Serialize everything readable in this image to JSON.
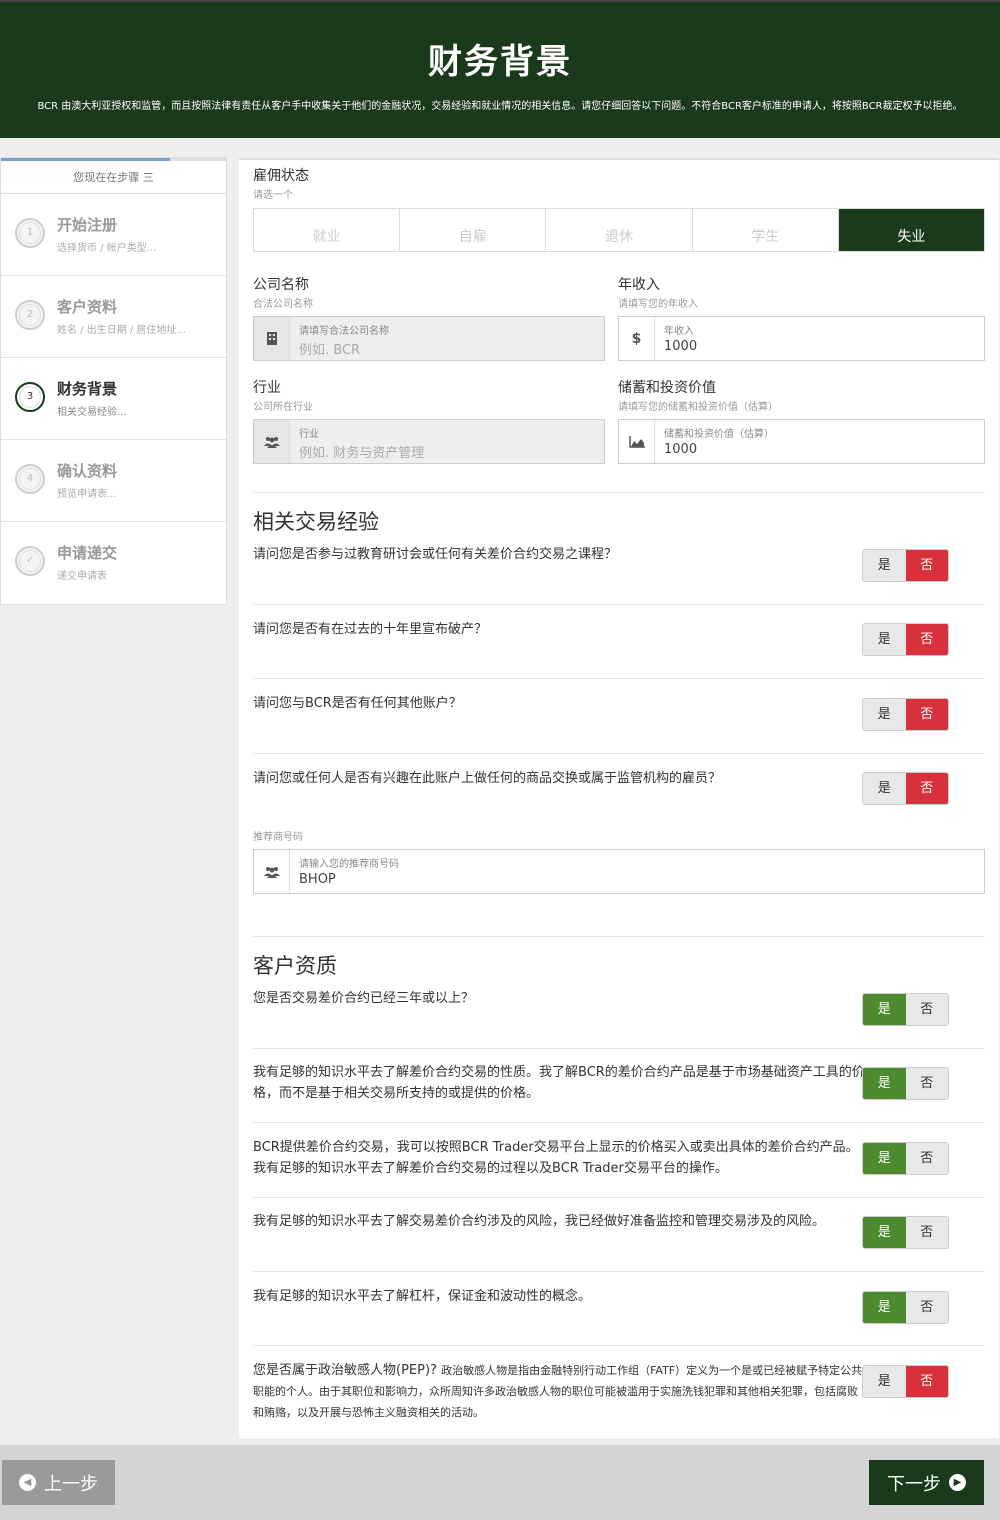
{
  "header": {
    "title": "财务背景",
    "notice": "BCR 由澳大利亚授权和监管，而且按照法律有责任从客户手中收集关于他们的金融状况，交易经验和就业情况的相关信息。请您仔细回答以下问题。不符合BCR客户标准的申请人，将按照BCR裁定权予以拒绝。"
  },
  "sidebar": {
    "progress": 0.75,
    "step_label": "您现在在步骤 三",
    "steps": [
      {
        "num": "1",
        "title": "开始注册",
        "sub": "选择货币 / 帐户类型..."
      },
      {
        "num": "2",
        "title": "客户资料",
        "sub": "姓名 / 出生日期 / 居住地址..."
      },
      {
        "num": "3",
        "title": "财务背景",
        "sub": "相关交易经验..."
      },
      {
        "num": "4",
        "title": "确认资料",
        "sub": "预览申请表..."
      },
      {
        "num": "✓",
        "title": "申请递交",
        "sub": "递交申请表"
      }
    ]
  },
  "employment": {
    "label": "雇佣状态",
    "hint": "请选一个",
    "options": [
      "就业",
      "自雇",
      "退休",
      "学生",
      "失业"
    ],
    "selected": "失业"
  },
  "company": {
    "label": "公司名称",
    "hint": "合法公司名称",
    "field_label": "请填写合法公司名称",
    "placeholder": "例如. BCR"
  },
  "income": {
    "label": "年收入",
    "hint": "请填写您的年收入",
    "field_label": "年收入",
    "value": "1000",
    "icon": "$"
  },
  "industry": {
    "label": "行业",
    "hint": "公司所在行业",
    "field_label": "行业",
    "placeholder": "例如. 财务与资产管理"
  },
  "savings": {
    "label": "储蓄和投资价值",
    "hint": "请填写您的储蓄和投资价值（估算）",
    "field_label": "储蓄和投资价值（估算）",
    "value": "1000"
  },
  "experience": {
    "title": "相关交易经验",
    "yes": "是",
    "no": "否",
    "questions": [
      {
        "text": "请问您是否参与过教育研讨会或任何有关差价合约交易之课程？",
        "answer": "否"
      },
      {
        "text": "请问您是否有在过去的十年里宣布破产？",
        "answer": "否"
      },
      {
        "text": "请问您与BCR是否有任何其他账户？",
        "answer": "否"
      },
      {
        "text": "请问您或任何人是否有兴趣在此账户上做任何的商品交换或属于监管机构的雇员？",
        "answer": "否"
      }
    ]
  },
  "referral": {
    "label": "推荐商号码",
    "field_label": "请输入您的推荐商号码",
    "value": "BHOP"
  },
  "qualification": {
    "title": "客户资质",
    "questions": [
      {
        "text": "您是否交易差价合约已经三年或以上？",
        "answer": "是"
      },
      {
        "text": "我有足够的知识水平去了解差价合约交易的性质。我了解BCR的差价合约产品是基于市场基础资产工具的价格，而不是基于相关交易所支持的或提供的价格。",
        "answer": "是"
      },
      {
        "text": "BCR提供差价合约交易，我可以按照BCR Trader交易平台上显示的价格买入或卖出具体的差价合约产品。我有足够的知识水平去了解差价合约交易的过程以及BCR Trader交易平台的操作。",
        "answer": "是"
      },
      {
        "text": "我有足够的知识水平去了解交易差价合约涉及的风险，我已经做好准备监控和管理交易涉及的风险。",
        "answer": "是"
      },
      {
        "text": "我有足够的知识水平去了解杠杆，保证金和波动性的概念。",
        "answer": "是"
      }
    ],
    "pep_lead": "您是否属于政治敏感人物(PEP)?",
    "pep_text": "政治敏感人物是指由金融特别行动工作组（FATF）定义为一个是或已经被赋予特定公共职能的个人。由于其职位和影响力，众所周知许多政治敏感人物的职位可能被滥用于实施洗钱犯罪和其他相关犯罪，包括腐败和贿赂，以及开展与恐怖主义融资相关的活动。",
    "pep_answer": "否"
  },
  "nav": {
    "prev": "上一步",
    "next": "下一步"
  },
  "colors": {
    "brand": "#1b3a1b",
    "no_active": "#d9313b",
    "yes_active": "#4e8a2f"
  }
}
